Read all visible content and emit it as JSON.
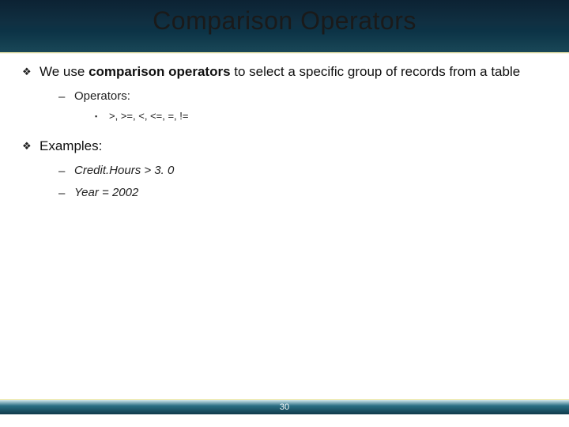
{
  "title": "Comparison Operators",
  "bullets": [
    {
      "level": 1,
      "text_prefix": "We use ",
      "text_bold": "comparison operators",
      "text_suffix": " to select a specific group of records from a table"
    },
    {
      "level": 2,
      "text": "Operators:"
    },
    {
      "level": 3,
      "text": ">, >=, <, <=, =, !="
    },
    {
      "level": 1,
      "text": "Examples:"
    },
    {
      "level": 2,
      "italic": true,
      "text": "Credit.Hours > 3. 0"
    },
    {
      "level": 2,
      "italic": true,
      "text": "Year = 2002"
    }
  ],
  "page_number": "30"
}
